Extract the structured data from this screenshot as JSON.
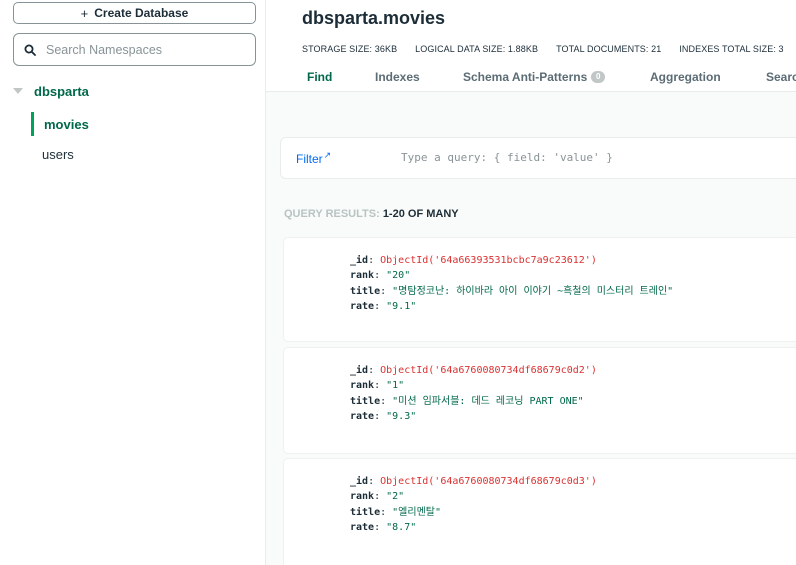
{
  "sidebar": {
    "create_database_label": "Create Database",
    "search_placeholder": "Search Namespaces",
    "database": "dbsparta",
    "collections": [
      {
        "name": "movies",
        "active": true
      },
      {
        "name": "users",
        "active": false
      }
    ]
  },
  "header": {
    "namespace": "dbsparta.movies",
    "stats": {
      "storage_size": "STORAGE SIZE: 36KB",
      "logical_data_size": "LOGICAL DATA SIZE: 1.88KB",
      "total_documents": "TOTAL DOCUMENTS: 21",
      "indexes_total_size": "INDEXES TOTAL SIZE: 3"
    },
    "tabs": [
      {
        "label": "Find",
        "active": true
      },
      {
        "label": "Indexes",
        "active": false
      },
      {
        "label": "Schema Anti-Patterns",
        "badge": "0",
        "active": false
      },
      {
        "label": "Aggregation",
        "active": false
      },
      {
        "label": "Searc",
        "active": false
      }
    ]
  },
  "filter": {
    "label": "Filter",
    "placeholder": "Type a query: { field: 'value' }"
  },
  "results": {
    "prefix": "QUERY RESULTS: ",
    "range": "1-20 OF MANY"
  },
  "documents": [
    {
      "_id": "ObjectId('64a66393531bcbc7a9c23612')",
      "rank": "\"20\"",
      "title": "\"명탐정코난: 하이바라 아이 이야기 ~흑철의 미스터리 트레인\"",
      "rate": "\"9.1\""
    },
    {
      "_id": "ObjectId('64a6760080734df68679c0d2')",
      "rank": "\"1\"",
      "title": "\"미션 임파서블: 데드 레코닝 PART ONE\"",
      "rate": "\"9.3\""
    },
    {
      "_id": "ObjectId('64a6760080734df68679c0d3')",
      "rank": "\"2\"",
      "title": "\"엘리멘탈\"",
      "rate": "\"8.7\""
    }
  ],
  "field_labels": {
    "id": "_id",
    "rank": "rank",
    "title": "title",
    "rate": "rate"
  },
  "colors": {
    "accent_green": "#00684a",
    "active_bar": "#00a35c",
    "link_blue": "#016bf8",
    "objectid_red": "#db3030"
  }
}
